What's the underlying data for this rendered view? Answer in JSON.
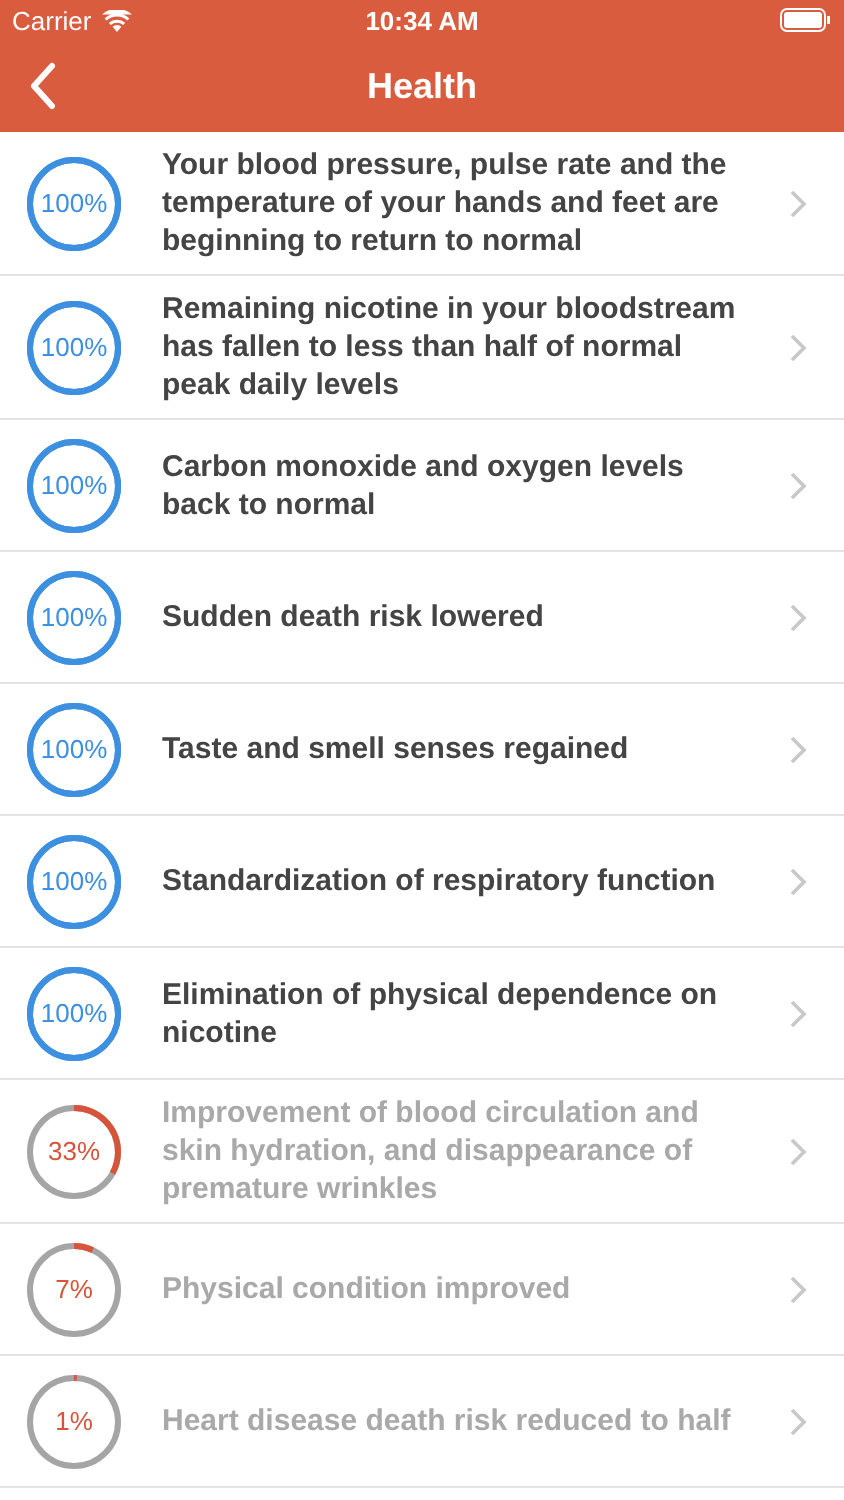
{
  "status_bar": {
    "carrier": "Carrier",
    "time": "10:34 AM"
  },
  "nav": {
    "title": "Health"
  },
  "items": [
    {
      "percent": "100%",
      "completed": true,
      "text": "Your blood pressure, pulse rate and the temperature of your hands and feet are beginning to return to normal"
    },
    {
      "percent": "100%",
      "completed": true,
      "text": "Remaining nicotine in your bloodstream has fallen to less than half of normal peak daily levels"
    },
    {
      "percent": "100%",
      "completed": true,
      "text": "Carbon monoxide and oxygen levels back to normal"
    },
    {
      "percent": "100%",
      "completed": true,
      "text": "Sudden death risk lowered"
    },
    {
      "percent": "100%",
      "completed": true,
      "text": "Taste and smell senses regained"
    },
    {
      "percent": "100%",
      "completed": true,
      "text": "Standardization of respiratory function"
    },
    {
      "percent": "100%",
      "completed": true,
      "text": "Elimination of physical dependence on nicotine"
    },
    {
      "percent": "33%",
      "completed": false,
      "text": "Improvement of blood circulation and skin hydration, and disappearance of premature wrinkles"
    },
    {
      "percent": "7%",
      "completed": false,
      "text": "Physical condition improved"
    },
    {
      "percent": "1%",
      "completed": false,
      "text": "Heart disease death risk reduced to half"
    }
  ]
}
